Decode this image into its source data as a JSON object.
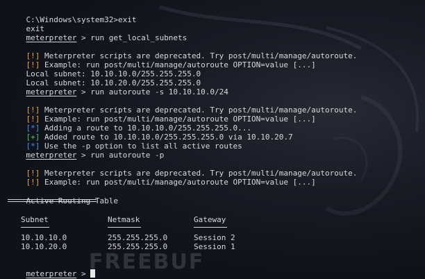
{
  "lines": {
    "l1": "C:\\Windows\\system32>exit",
    "l2": "exit",
    "prompt": "meterpreter",
    "cmd1": " > run get_local_subnets",
    "warn_tag": "[!]",
    "info_tag": "[*]",
    "ok_tag": "[+]",
    "dep1": " Meterpreter scripts are deprecated. Try post/multi/manage/autoroute.",
    "ex1": " Example: run post/multi/manage/autoroute OPTION=value [...]",
    "sub1": "Local subnet: 10.10.10.0/255.255.255.0",
    "sub2": "Local subnet: 10.10.20.0/255.255.255.0",
    "cmd2": " > run autoroute -s 10.10.10.0/24",
    "dep2": " Meterpreter scripts are deprecated. Try post/multi/manage/autoroute.",
    "ex2": " Example: run post/multi/manage/autoroute OPTION=value [...]",
    "adding": " Adding a route to 10.10.10.0/255.255.255.0...",
    "added": " Added route to 10.10.10.0/255.255.255.0 via 10.10.20.7",
    "usep": " Use the -p option to list all active routes",
    "cmd3": " > run autoroute -p",
    "dep3": " Meterpreter scripts are deprecated. Try post/multi/manage/autoroute.",
    "ex3": " Example: run post/multi/manage/autoroute OPTION=value [...]",
    "table_title": "Active Routing Table",
    "final_prompt_tail": " > "
  },
  "table": {
    "headers": [
      "Subnet",
      "Netmask",
      "Gateway"
    ],
    "rows": [
      [
        "10.10.10.0",
        "255.255.255.0",
        "Session 2"
      ],
      [
        "10.10.20.0",
        "255.255.255.0",
        "Session 1"
      ]
    ]
  },
  "watermark": "FREEBUF",
  "colors": {
    "warn": "#f1a640",
    "info": "#4a8fe8",
    "ok": "#4cc06a",
    "background": "#10121a"
  }
}
